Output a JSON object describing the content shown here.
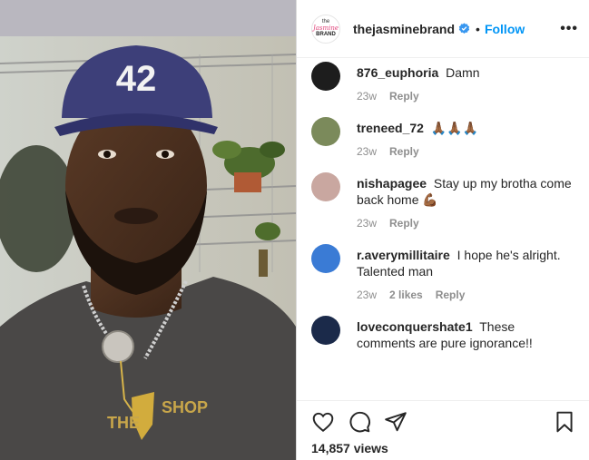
{
  "media": {
    "cap_number": "42",
    "shirt_text_left": "THE",
    "shirt_text_right": "SHOP"
  },
  "post": {
    "brand_logo": {
      "line1": "the",
      "line2": "Jasmine",
      "line3": "BRAND"
    },
    "account_handle": "thejasminebrand",
    "separator": "•",
    "follow_label": "Follow",
    "more_label": "•••"
  },
  "comments": [
    {
      "username": "876_euphoria",
      "text": "Damn",
      "time": "23w",
      "likes": "",
      "reply_label": "Reply",
      "avatar_color": "#1d1d1d"
    },
    {
      "username": "treneed_72",
      "text": "🙏🏾🙏🏾🙏🏾",
      "time": "23w",
      "likes": "",
      "reply_label": "Reply",
      "avatar_color": "#7b8a5b"
    },
    {
      "username": "nishapagee",
      "text": "Stay up my brotha come back home 💪🏾",
      "time": "23w",
      "likes": "",
      "reply_label": "Reply",
      "avatar_color": "#c9a7a0"
    },
    {
      "username": "r.averymillitaire",
      "text": "I hope he's alright. Talented man",
      "time": "23w",
      "likes": "2 likes",
      "reply_label": "Reply",
      "avatar_color": "#3a7bd5"
    },
    {
      "username": "loveconquershate1",
      "text": "These comments are pure ignorance!!",
      "time": "",
      "likes": "",
      "reply_label": "",
      "avatar_color": "#1b2a4a"
    }
  ],
  "actions": {
    "icons": [
      "heart-icon",
      "comment-icon",
      "share-icon",
      "bookmark-icon"
    ],
    "views": "14,857 views"
  },
  "colors": {
    "link": "#0095f6",
    "meta": "#8e8e8e",
    "text": "#262626",
    "verified": "#3897f0"
  }
}
